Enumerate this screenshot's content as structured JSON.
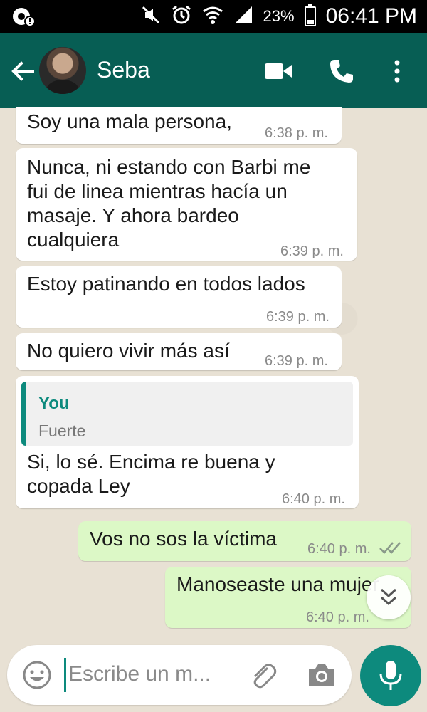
{
  "status_bar": {
    "battery_percent": "23%",
    "time": "06:41 PM"
  },
  "header": {
    "contact_name": "Seba"
  },
  "messages": [
    {
      "direction": "in",
      "text_lines": [
        "Soy una mala persona,"
      ],
      "time": "6:38 p. m."
    },
    {
      "direction": "in",
      "text_lines": [
        "Nunca, ni estando con Barbi me",
        "fui de linea mientras hacía un",
        "masaje. Y ahora bardeo",
        "cualquiera"
      ],
      "time": "6:39 p. m."
    },
    {
      "direction": "in",
      "text_lines": [
        "Estoy patinando en todos lados"
      ],
      "time": "6:39 p. m."
    },
    {
      "direction": "in",
      "text_lines": [
        "No quiero vivir más así"
      ],
      "time": "6:39 p. m."
    },
    {
      "direction": "in",
      "quote": {
        "author": "You",
        "text": "Fuerte"
      },
      "text_lines": [
        "Si, lo sé. Encima re buena y",
        "copada Ley"
      ],
      "time": "6:40 p. m."
    },
    {
      "direction": "out",
      "text_lines": [
        "Vos no sos la víctima"
      ],
      "time": "6:40 p. m.",
      "ticks": "read"
    },
    {
      "direction": "out",
      "text_lines": [
        "Manoseaste una mujer"
      ],
      "time": "6:40 p. m."
    }
  ],
  "composer": {
    "placeholder": "Escribe un m..."
  },
  "colors": {
    "header": "#075e54",
    "accent": "#0d8a7d",
    "outgoing_bubble": "#dcf8c6",
    "incoming_bubble": "#ffffff"
  },
  "icons": [
    "data-saver-icon",
    "mute-icon",
    "alarm-icon",
    "wifi-icon",
    "signal-icon",
    "battery-icon",
    "back-arrow-icon",
    "video-call-icon",
    "phone-icon",
    "more-options-icon",
    "double-check-icon",
    "scroll-down-icon",
    "emoji-icon",
    "attach-icon",
    "camera-icon",
    "mic-icon"
  ]
}
